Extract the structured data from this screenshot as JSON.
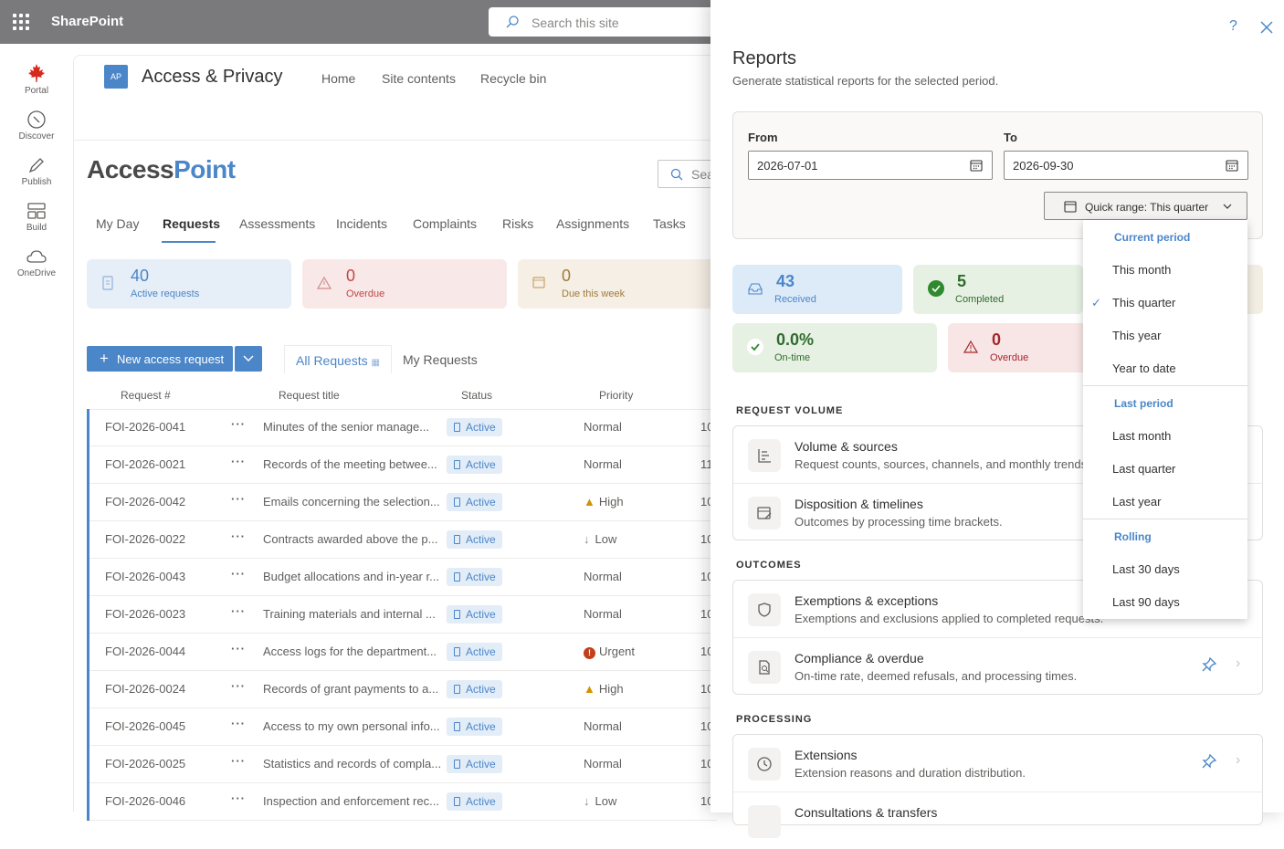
{
  "suite": {
    "brand": "SharePoint",
    "search_placeholder": "Search this site"
  },
  "rail": [
    {
      "label": "Portal",
      "icon": "maple-leaf-icon"
    },
    {
      "label": "Discover",
      "icon": "compass-icon"
    },
    {
      "label": "Publish",
      "icon": "pen-icon"
    },
    {
      "label": "Build",
      "icon": "build-icon"
    },
    {
      "label": "OneDrive",
      "icon": "cloud-icon"
    }
  ],
  "site": {
    "badge": "AP",
    "title": "Access & Privacy",
    "nav": [
      "Home",
      "Site contents",
      "Recycle bin"
    ],
    "logo_a": "Access",
    "logo_b": "Point",
    "search_text": "Sea",
    "tabs": [
      "My Day",
      "Requests",
      "Assessments",
      "Incidents",
      "Complaints",
      "Risks",
      "Assignments",
      "Tasks"
    ],
    "kpis": [
      {
        "value": "40",
        "label": "Active requests"
      },
      {
        "value": "0",
        "label": "Overdue"
      },
      {
        "value": "0",
        "label": "Due this week"
      }
    ],
    "new_button": "New access request",
    "view_tabs": [
      "All Requests",
      "My Requests"
    ],
    "columns": [
      "Request #",
      "Request title",
      "Status",
      "Priority"
    ],
    "rows": [
      {
        "id": "FOI-2026-0041",
        "title": "Minutes of the senior manage...",
        "status": "Active",
        "priority": "Normal",
        "extra": "10"
      },
      {
        "id": "FOI-2026-0021",
        "title": "Records of the meeting betwee...",
        "status": "Active",
        "priority": "Normal",
        "extra": "11"
      },
      {
        "id": "FOI-2026-0042",
        "title": "Emails concerning the selection...",
        "status": "Active",
        "priority": "High",
        "extra": "10"
      },
      {
        "id": "FOI-2026-0022",
        "title": "Contracts awarded above the p...",
        "status": "Active",
        "priority": "Low",
        "extra": "10"
      },
      {
        "id": "FOI-2026-0043",
        "title": "Budget allocations and in-year r...",
        "status": "Active",
        "priority": "Normal",
        "extra": "10"
      },
      {
        "id": "FOI-2026-0023",
        "title": "Training materials and internal ...",
        "status": "Active",
        "priority": "Normal",
        "extra": "10"
      },
      {
        "id": "FOI-2026-0044",
        "title": "Access logs for the department...",
        "status": "Active",
        "priority": "Urgent",
        "extra": "10"
      },
      {
        "id": "FOI-2026-0024",
        "title": "Records of grant payments to a...",
        "status": "Active",
        "priority": "High",
        "extra": "10"
      },
      {
        "id": "FOI-2026-0045",
        "title": "Access to my own personal info...",
        "status": "Active",
        "priority": "Normal",
        "extra": "10"
      },
      {
        "id": "FOI-2026-0025",
        "title": "Statistics and records of compla...",
        "status": "Active",
        "priority": "Normal",
        "extra": "10"
      },
      {
        "id": "FOI-2026-0046",
        "title": "Inspection and enforcement rec...",
        "status": "Active",
        "priority": "Low",
        "extra": "10"
      }
    ]
  },
  "panel": {
    "title": "Reports",
    "subtitle": "Generate statistical reports for the selected period.",
    "help": "?",
    "from_label": "From",
    "from_value": "2026-07-01",
    "to_label": "To",
    "to_value": "2026-09-30",
    "quick_range": "Quick range: This quarter",
    "kpis": [
      {
        "value": "43",
        "label": "Received"
      },
      {
        "value": "5",
        "label": "Completed"
      },
      {
        "value": "0.0%",
        "label": "On-time"
      },
      {
        "value": "0",
        "label": "Overdue"
      }
    ],
    "sections": [
      {
        "heading": "REQUEST VOLUME",
        "items": [
          {
            "title": "Volume & sources",
            "desc": "Request counts, sources, channels, and monthly trends."
          },
          {
            "title": "Disposition & timelines",
            "desc": "Outcomes by processing time brackets."
          }
        ]
      },
      {
        "heading": "OUTCOMES",
        "items": [
          {
            "title": "Exemptions & exceptions",
            "desc": "Exemptions and exclusions applied to completed requests."
          },
          {
            "title": "Compliance & overdue",
            "desc": "On-time rate, deemed refusals, and processing times."
          }
        ]
      },
      {
        "heading": "PROCESSING",
        "items": [
          {
            "title": "Extensions",
            "desc": "Extension reasons and duration distribution."
          },
          {
            "title": "Consultations & transfers",
            "desc": ""
          }
        ]
      }
    ]
  },
  "menu": {
    "groups": [
      {
        "heading": "Current period",
        "items": [
          "This month",
          "This quarter",
          "This year",
          "Year to date"
        ]
      },
      {
        "heading": "Last period",
        "items": [
          "Last month",
          "Last quarter",
          "Last year"
        ]
      },
      {
        "heading": "Rolling",
        "items": [
          "Last 30 days",
          "Last 90 days"
        ]
      }
    ],
    "selected": "This quarter"
  },
  "colors": {
    "accent": "#4a86c8",
    "suite_bar": "#7a7a7d",
    "overdue": "#a4262c",
    "completed": "#107c10"
  }
}
